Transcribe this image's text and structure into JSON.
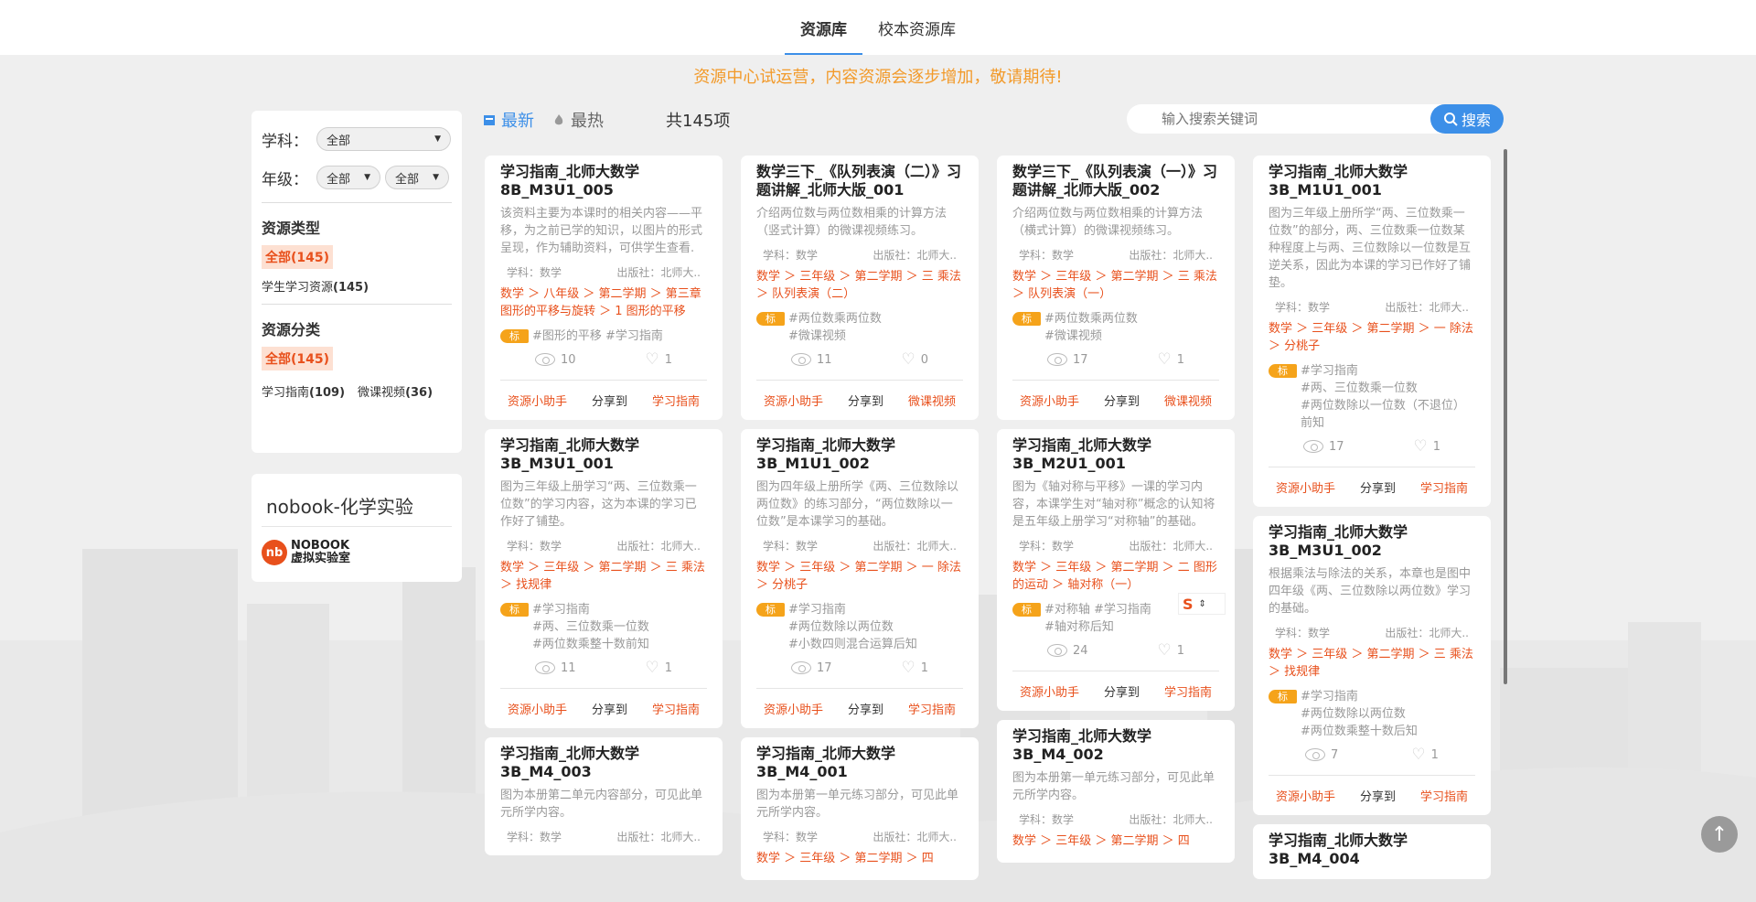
{
  "tabs": [
    {
      "label": "资源库",
      "active": true
    },
    {
      "label": "校本资源库",
      "active": false
    }
  ],
  "notice": "资源中心试运营，内容资源会逐步增加，敬请期待!",
  "filters": {
    "subject_label": "学科：",
    "subject_value": "全部",
    "grade_label": "年级：",
    "grade_value1": "全部",
    "grade_value2": "全部"
  },
  "resource_type": {
    "title": "资源类型",
    "all_label": "全部(145)",
    "item_label": "学生学习资源",
    "item_count": "(145)"
  },
  "resource_category": {
    "title": "资源分类",
    "all_label": "全部(145)",
    "item1_label": "学习指南",
    "item1_count": "(109)",
    "item2_label": "微课视频",
    "item2_count": "(36)"
  },
  "nobook": {
    "title": "nobook-化学实验",
    "logo_letters": "nb",
    "logo_line1": "NOBOOK",
    "logo_line2": "虚拟实验室"
  },
  "sort": {
    "newest": "最新",
    "hottest": "最热",
    "total": "共145项"
  },
  "search": {
    "placeholder": "输入搜索关键词",
    "button": "搜索"
  },
  "badge_label": "标",
  "meta_labels": {
    "subject": "学科：数学",
    "publisher": "出版社：北师大.."
  },
  "actions": {
    "helper": "资源小助手",
    "share": "分享到"
  },
  "columns": [
    [
      {
        "title": "学习指南_北师大数学8B_M3U1_005",
        "desc": "该资料主要为本课时的相关内容——平移，为之前已学的知识，以图片的形式呈现，作为辅助资料，可供学生查看.",
        "path": "数学 ＞ 八年级 ＞ 第二学期 ＞ 第三章 图形的平移与旋转 ＞ 1 图形的平移",
        "tags": "#图形的平移 #学习指南",
        "views": "10",
        "likes": "1",
        "type": "学习指南"
      },
      {
        "title": "学习指南_北师大数学3B_M3U1_001",
        "desc": "图为三年级上册学习“两、三位数乘一位数”的学习内容，这为本课的学习已作好了铺垫。",
        "path": "数学 ＞ 三年级 ＞ 第二学期 ＞ 三 乘法 ＞ 找规律",
        "tags": "#学习指南\n#两、三位数乘一位数\n#两位数乘整十数前知",
        "views": "11",
        "likes": "1",
        "type": "学习指南"
      },
      {
        "title": "学习指南_北师大数学3B_M4_003",
        "desc": "图为本册第二单元内容部分，可见此单元所学内容。",
        "path": "",
        "tags": "",
        "views": "",
        "likes": "",
        "type": ""
      }
    ],
    [
      {
        "title": "数学三下_《队列表演（二）》习题讲解_北师大版_001",
        "desc": "介绍两位数与两位数相乘的计算方法（竖式计算）的微课视频练习。",
        "path": "数学 ＞ 三年级 ＞ 第二学期 ＞ 三 乘法 ＞ 队列表演（二）",
        "tags": "#两位数乘两位数\n#微课视频",
        "views": "11",
        "likes": "0",
        "type": "微课视频"
      },
      {
        "title": "学习指南_北师大数学3B_M1U1_002",
        "desc": "图为四年级上册所学《两、三位数除以两位数》的练习部分，“两位数除以一位数”是本课学习的基础。",
        "path": "数学 ＞ 三年级 ＞ 第二学期 ＞ 一 除法 ＞ 分桃子",
        "tags": "#学习指南\n#两位数除以两位数\n#小数四则混合运算后知",
        "views": "17",
        "likes": "1",
        "type": "学习指南"
      },
      {
        "title": "学习指南_北师大数学3B_M4_001",
        "desc": "图为本册第一单元练习部分，可见此单元所学内容。",
        "path": "数学 ＞ 三年级 ＞ 第二学期 ＞ 四",
        "tags": "",
        "views": "",
        "likes": "",
        "type": ""
      }
    ],
    [
      {
        "title": "数学三下_《队列表演（一）》习题讲解_北师大版_002",
        "desc": "介绍两位数与两位数相乘的计算方法（横式计算）的微课视频练习。",
        "path": "数学 ＞ 三年级 ＞ 第二学期 ＞ 三 乘法 ＞ 队列表演（一）",
        "tags": "#两位数乘两位数\n#微课视频",
        "views": "17",
        "likes": "1",
        "type": "微课视频"
      },
      {
        "title": "学习指南_北师大数学3B_M2U1_001",
        "desc": "图为《轴对称与平移》一课的学习内容，本课学生对“轴对称”概念的认知将是五年级上册学习“对称轴”的基础。",
        "path": "数学 ＞ 三年级 ＞ 第二学期 ＞ 二 图形的运动 ＞ 轴对称（一）",
        "tags": "#对称轴 #学习指南\n#轴对称后知",
        "views": "24",
        "likes": "1",
        "type": "学习指南"
      },
      {
        "title": "学习指南_北师大数学3B_M4_002",
        "desc": "图为本册第一单元练习部分，可见此单元所学内容。",
        "path": "数学 ＞ 三年级 ＞ 第二学期 ＞ 四",
        "tags": "",
        "views": "",
        "likes": "",
        "type": ""
      }
    ],
    [
      {
        "title": "学习指南_北师大数学3B_M1U1_001",
        "desc": "图为三年级上册所学“两、三位数乘一位数”的部分，两、三位数乘一位数某种程度上与两、三位数除以一位数是互逆关系，因此为本课的学习已作好了铺垫。",
        "path": "数学 ＞ 三年级 ＞ 第二学期 ＞ 一 除法 ＞ 分桃子",
        "tags": "#学习指南\n#两、三位数乘一位数\n#两位数除以一位数（不退位）前知",
        "views": "17",
        "likes": "1",
        "type": "学习指南"
      },
      {
        "title": "学习指南_北师大数学3B_M3U1_002",
        "desc": "根据乘法与除法的关系，本章也是图中四年级《两、三位数除以两位数》学习的基础。",
        "path": "数学 ＞ 三年级 ＞ 第二学期 ＞ 三 乘法 ＞ 找规律",
        "tags": "#学习指南\n#两位数除以两位数\n#两位数乘整十数后知",
        "views": "7",
        "likes": "1",
        "type": "学习指南"
      },
      {
        "title": "学习指南_北师大数学3B_M4_004",
        "desc": "",
        "path": "",
        "tags": "",
        "views": "",
        "likes": "",
        "type": ""
      }
    ]
  ],
  "colors": {
    "accent": "#3c8fe8",
    "orange": "#e8501c",
    "notice": "#f29a2a",
    "badge": "#f5a31a"
  }
}
